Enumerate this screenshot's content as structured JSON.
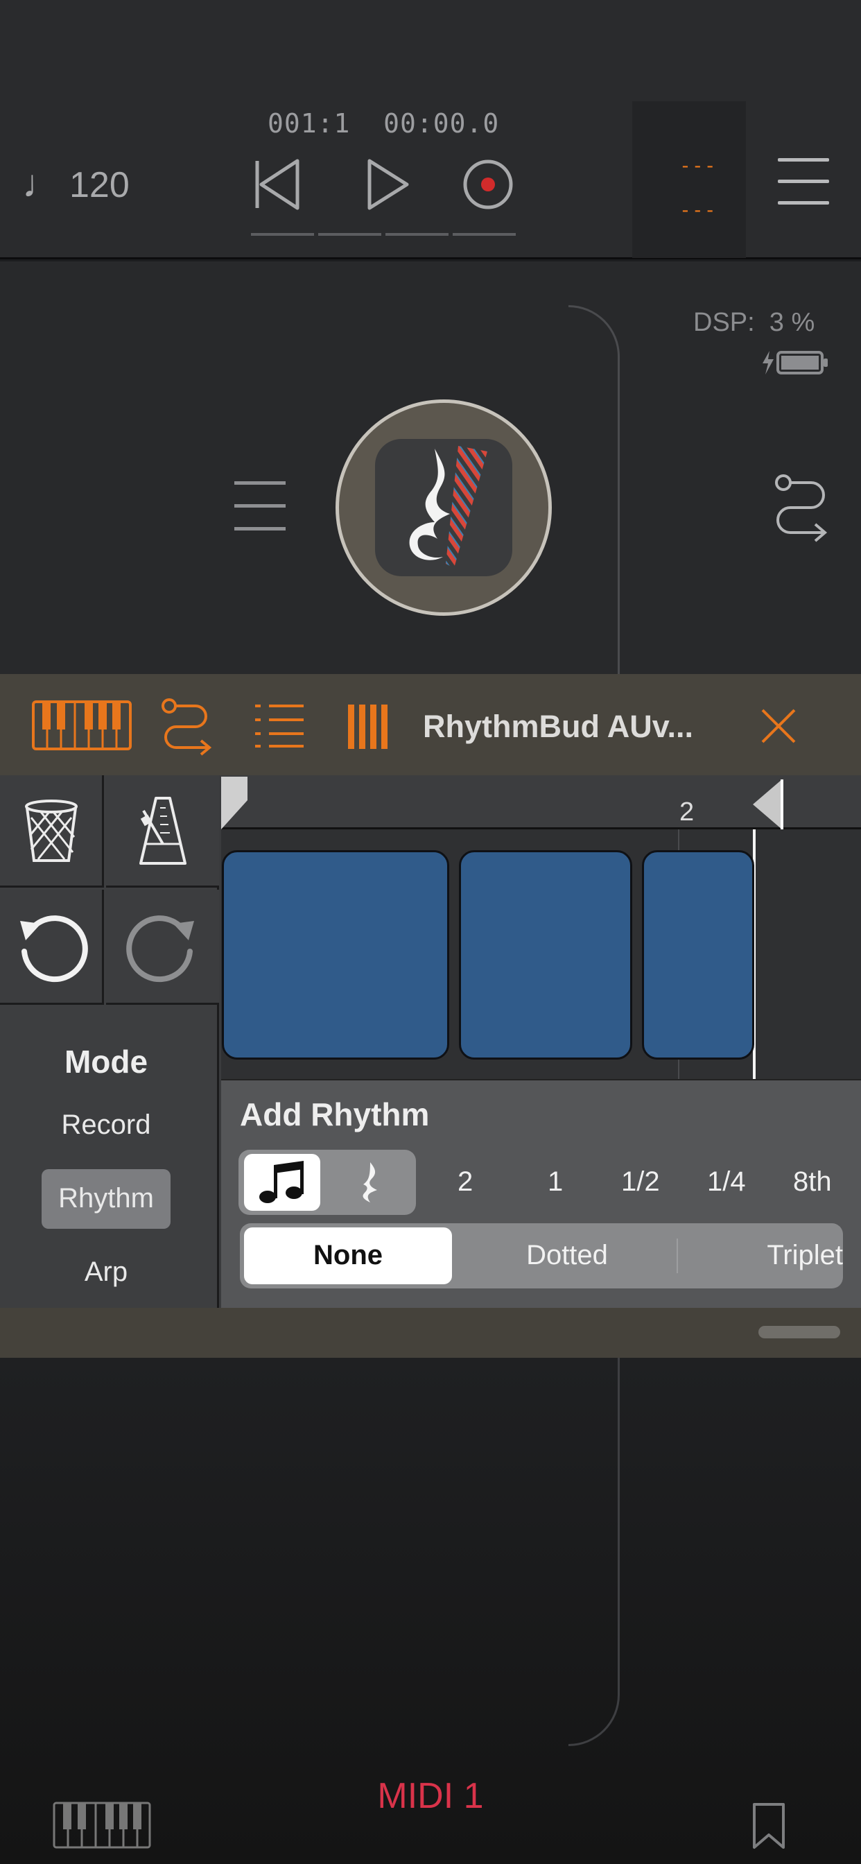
{
  "transport": {
    "tempo": "120",
    "tempo_icon": "quarter-note-icon",
    "position": "001:1  00:00.0",
    "channel_top": "---",
    "channel_bottom": "---"
  },
  "host": {
    "dsp": "DSP:  3 %",
    "plugin_icon": "rhythmbud-app-icon"
  },
  "plugin": {
    "name": "RhythmBud AUv...",
    "accent": "#e8761c"
  },
  "timeline": {
    "bar_marker": "2",
    "block_color": "#305b8a"
  },
  "mode": {
    "title": "Mode",
    "items": [
      "Record",
      "Rhythm",
      "Arp"
    ],
    "selected": "Rhythm"
  },
  "add_rhythm": {
    "title": "Add Rhythm",
    "durations": [
      "2",
      "1",
      "1/2",
      "1/4",
      "8th"
    ],
    "modifiers": [
      "None",
      "Dotted",
      "Triplet"
    ],
    "selected_modifier": "None"
  },
  "footer": {
    "label": "MIDI 1",
    "accent": "#d9334a"
  }
}
